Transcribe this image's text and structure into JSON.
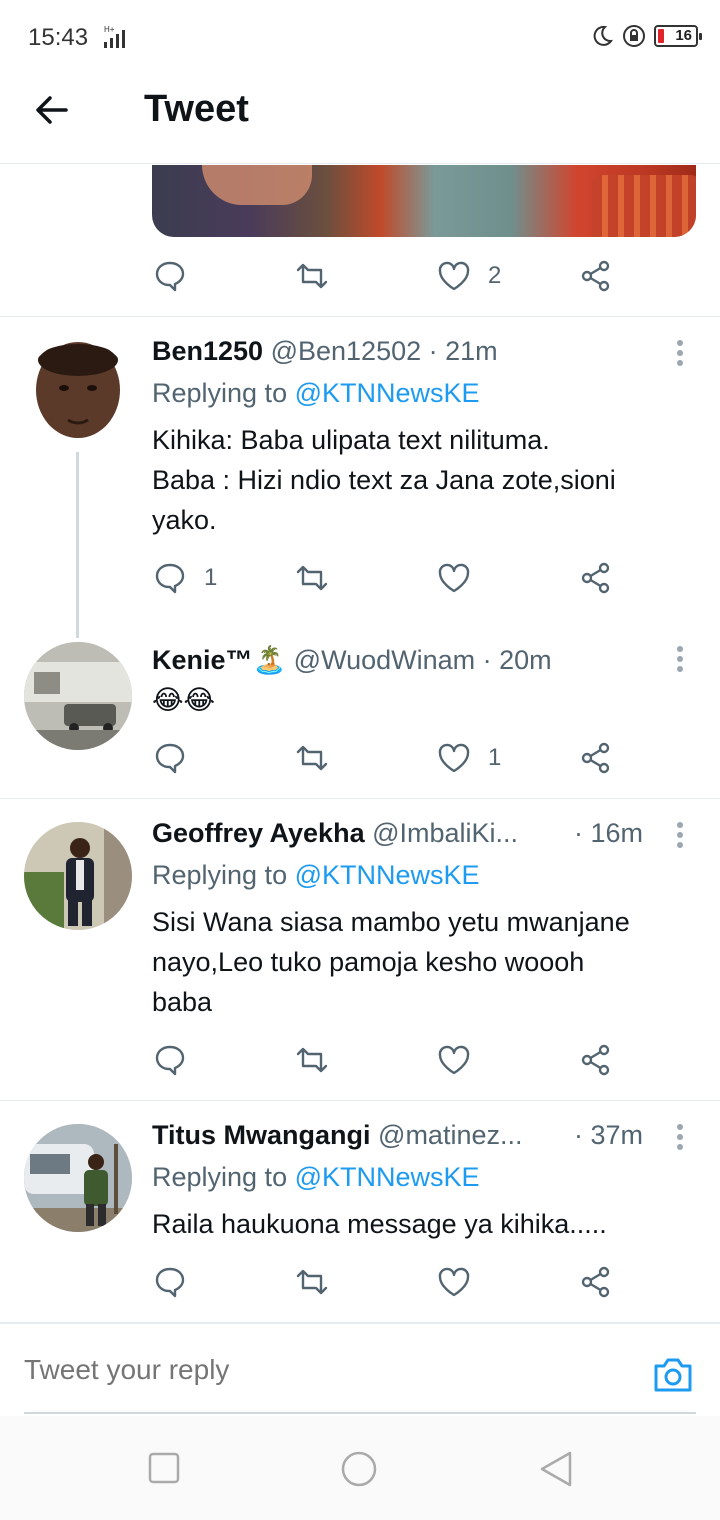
{
  "status_bar": {
    "time": "15:43",
    "network": "H+",
    "battery": "16"
  },
  "header": {
    "title": "Tweet"
  },
  "top_actions": {
    "like_count": "2"
  },
  "tweets": [
    {
      "name": "Ben1250",
      "handle": "@Ben12502",
      "time": "· 21m",
      "replying_prefix": "Replying to",
      "mention": "@KTNNewsKE",
      "text_lines": [
        "Kihika: Baba ulipata text nilituma.",
        "Baba : Hizi ndio text za Jana zote,sioni",
        "yako."
      ],
      "reply_count": "1",
      "like_count": ""
    },
    {
      "name": "Kenie™🏝️",
      "handle": "@WuodWinam",
      "time": "· 20m",
      "text_lines": [
        "😂😂"
      ],
      "reply_count": "",
      "like_count": "1"
    },
    {
      "name": "Geoffrey Ayekha",
      "handle": "@ImbaliKi...",
      "time": "· 16m",
      "replying_prefix": "Replying to",
      "mention": "@KTNNewsKE",
      "text_lines": [
        "Sisi Wana siasa mambo yetu mwanjane",
        "nayo,Leo tuko pamoja kesho woooh",
        "baba"
      ],
      "reply_count": "",
      "like_count": ""
    },
    {
      "name": "Titus Mwangangi",
      "handle": "@matinez...",
      "time": "· 37m",
      "replying_prefix": "Replying to",
      "mention": "@KTNNewsKE",
      "text_lines": [
        "Raila haukuona message ya kihika....."
      ],
      "reply_count": "",
      "like_count": ""
    }
  ],
  "composer": {
    "placeholder": "Tweet your reply"
  },
  "colors": {
    "accent": "#1d9bf0",
    "muted": "#536471",
    "text": "#0f1419",
    "divider": "#e6ecf0"
  },
  "icons": [
    "back-arrow-icon",
    "reply-icon",
    "retweet-icon",
    "like-icon",
    "share-icon",
    "more-vertical-icon",
    "camera-icon",
    "recents-icon",
    "home-icon",
    "back-nav-icon"
  ]
}
